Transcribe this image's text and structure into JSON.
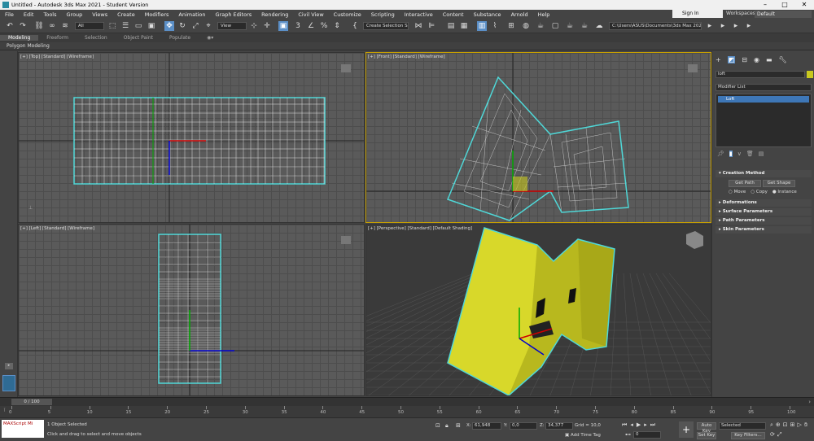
{
  "window": {
    "title": "Untitled - Autodesk 3ds Max 2021 - Student Version"
  },
  "menu": [
    "File",
    "Edit",
    "Tools",
    "Group",
    "Views",
    "Create",
    "Modifiers",
    "Animation",
    "Graph Editors",
    "Rendering",
    "Civil View",
    "Customize",
    "Scripting",
    "Interactive",
    "Content",
    "Substance",
    "Arnold",
    "Help"
  ],
  "account": {
    "signin": "Sign In",
    "workspaces_label": "Workspaces:",
    "workspace_value": "Default"
  },
  "toolbar": {
    "filter": "All",
    "refcoord": "View",
    "selection_set": "Create Selection Se",
    "project_path": "C:\\Users\\ASUS\\Documents\\3ds Max 2021"
  },
  "ribbon": {
    "tabs": [
      "Modeling",
      "Freeform",
      "Selection",
      "Object Paint",
      "Populate"
    ],
    "sub": "Polygon Modeling"
  },
  "viewports": {
    "top": "[+] [Top] [Standard] [Wireframe]",
    "front": "[+] [Front] [Standard] [Wireframe]",
    "left": "[+] [Left] [Standard] [Wireframe]",
    "persp": "[+] [Perspective] [Standard] [Default Shading]"
  },
  "panel": {
    "object_name": "loft",
    "modifier_list": "Modifier List",
    "stack_item": "Loft",
    "creation_method": "Creation Method",
    "get_path": "Get Path",
    "get_shape": "Get Shape",
    "move": "Move",
    "copy": "Copy",
    "instance": "Instance",
    "rollouts": [
      "Deformations",
      "Surface Parameters",
      "Path Parameters",
      "Skin Parameters"
    ]
  },
  "timeline": {
    "frame": "0 / 100",
    "ticks": [
      "0",
      "5",
      "10",
      "15",
      "20",
      "25",
      "30",
      "35",
      "40",
      "45",
      "50",
      "55",
      "60",
      "65",
      "70",
      "75",
      "80",
      "85",
      "90",
      "95",
      "100"
    ]
  },
  "status": {
    "script": "MAXScript Mi",
    "selected": "1 Object Selected",
    "prompt": "Click and drag to select and move objects",
    "x_label": "X:",
    "x": "61,948",
    "y_label": "Y:",
    "y": "0,0",
    "z_label": "Z:",
    "z": "34,377",
    "grid": "Grid = 10,0",
    "add_time_tag": "Add Time Tag",
    "auto_key": "Auto Key",
    "set_key": "Set Key",
    "selected_dd": "Selected",
    "key_filters": "Key Filters...",
    "frame_field": "0"
  },
  "colors": {
    "selection": "#4fd8d8",
    "object": "#c8c81e",
    "active_border": "#c8a000"
  }
}
